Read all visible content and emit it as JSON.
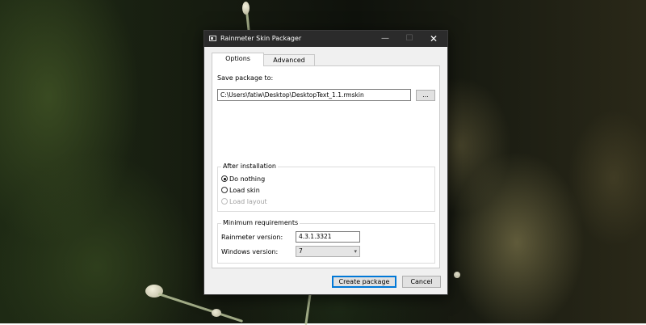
{
  "window": {
    "title": "Rainmeter Skin Packager",
    "controls": {
      "minimize": "—",
      "maximize": "☐",
      "close": "✕"
    }
  },
  "tabs": [
    {
      "label": "Options",
      "selected": true
    },
    {
      "label": "Advanced",
      "selected": false
    }
  ],
  "save_package": {
    "label": "Save package to:",
    "path_value": "C:\\Users\\fatiw\\Desktop\\DesktopText_1.1.rmskin",
    "browse_label": "..."
  },
  "after_installation": {
    "title": "After installation",
    "options": [
      {
        "label": "Do nothing",
        "checked": true,
        "enabled": true
      },
      {
        "label": "Load skin",
        "checked": false,
        "enabled": true
      },
      {
        "label": "Load layout",
        "checked": false,
        "enabled": false
      }
    ]
  },
  "minimum_requirements": {
    "title": "Minimum requirements",
    "rainmeter_label": "Rainmeter version:",
    "rainmeter_value": "4.3.1.3321",
    "windows_label": "Windows version:",
    "windows_value": "7"
  },
  "footer": {
    "create_label": "Create package",
    "cancel_label": "Cancel"
  },
  "icons": {
    "app": "rainmeter-app-icon",
    "dropdown": "chevron-down-icon"
  }
}
